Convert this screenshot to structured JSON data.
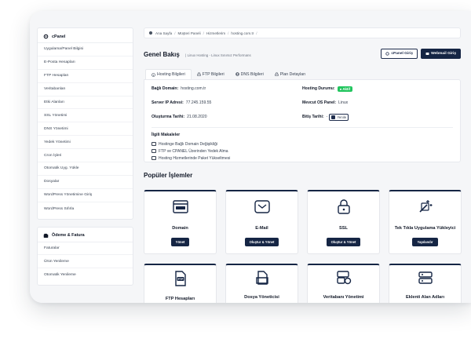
{
  "sidebar": {
    "cpanel": {
      "title": "cPanel",
      "items": [
        "Uygulama/Panel Bilgisi",
        "E-Posta Hesapları",
        "FTP Hesapları",
        "Veritabanları",
        "Etki Alanları",
        "SSL Yönetimi",
        "DNS Yönetimi",
        "Yedek Yönetimi",
        "Cron İşleri",
        "Otomatik Uyg. Yükle",
        "Dosyalar",
        "WordPress Yönetimine Giriş",
        "WordPress Sıfırla"
      ]
    },
    "billing": {
      "title": "Ödeme & Fatura",
      "items": [
        "Faturalar",
        "Ürün Yenileme",
        "Otomatik Yenileme"
      ]
    }
  },
  "breadcrumb": [
    "Ana Sayfa",
    "Müşteri Paneli",
    "Hizmetlerim",
    "hosting.com.tr"
  ],
  "header": {
    "title": "Genel Bakış",
    "subtitle": "Linux Hosting - Linux Sınırsız Performans",
    "cpanel_button": "cPanel Giriş",
    "webmail_button": "Webmail Giriş"
  },
  "tabs": [
    {
      "label": "Hosting Bilgileri",
      "icon": "info-icon",
      "active": true
    },
    {
      "label": "FTP Bilgileri",
      "icon": "lock-icon",
      "active": false
    },
    {
      "label": "DNS Bilgileri",
      "icon": "globe-icon",
      "active": false
    },
    {
      "label": "Plan Detayları",
      "icon": "lock-icon",
      "active": false
    }
  ],
  "info": {
    "domain_label": "Bağlı Domain:",
    "domain_value": "hosting.com.tr",
    "status_label": "Hosting Durumu:",
    "status_value": "Aktif",
    "ip_label": "Server IP Adresi:",
    "ip_value": "77.245.159.55",
    "os_label": "Mevcut OS Panel:",
    "os_value": "Linux",
    "created_label": "Oluşturma Tarihi:",
    "created_value": "21.08.2020",
    "end_label": "Bitiş Tarihi:",
    "end_value": "-",
    "renew_button": "Yenile"
  },
  "articles": {
    "title": "İlgili Makaleler",
    "items": [
      "Hostinge Bağlı Domain Değişikliği",
      "FTP ve CPANEL Üzerinden Yedek Alma",
      "Hosting Hizmetlerinde Paket Yükseltmesi"
    ]
  },
  "popular": {
    "title": "Popüler İşlemler",
    "tiles": [
      {
        "name": "Domain",
        "button": "Yönet",
        "icon": "browser-icon"
      },
      {
        "name": "E-Mail",
        "button": "Oluştur & Yönet",
        "icon": "envelope-icon"
      },
      {
        "name": "SSL",
        "button": "Oluştur & Yönet",
        "icon": "padlock-icon"
      },
      {
        "name": "Tek Tıkla Uygulama Yükleyici",
        "button": "Yapılandır",
        "icon": "magic-install-icon"
      }
    ],
    "tiles2": [
      {
        "name": "FTP Hesapları",
        "icon": "ftp-icon"
      },
      {
        "name": "Dosya Yöneticisi",
        "icon": "folder-icon"
      },
      {
        "name": "Veritabanı Yönetimi",
        "icon": "database-icon"
      },
      {
        "name": "Eklenti Alan Adları",
        "icon": "domain-icon"
      }
    ]
  },
  "colors": {
    "navy": "#152544",
    "active_green": "#22c55e",
    "background": "#f5f6f8"
  }
}
